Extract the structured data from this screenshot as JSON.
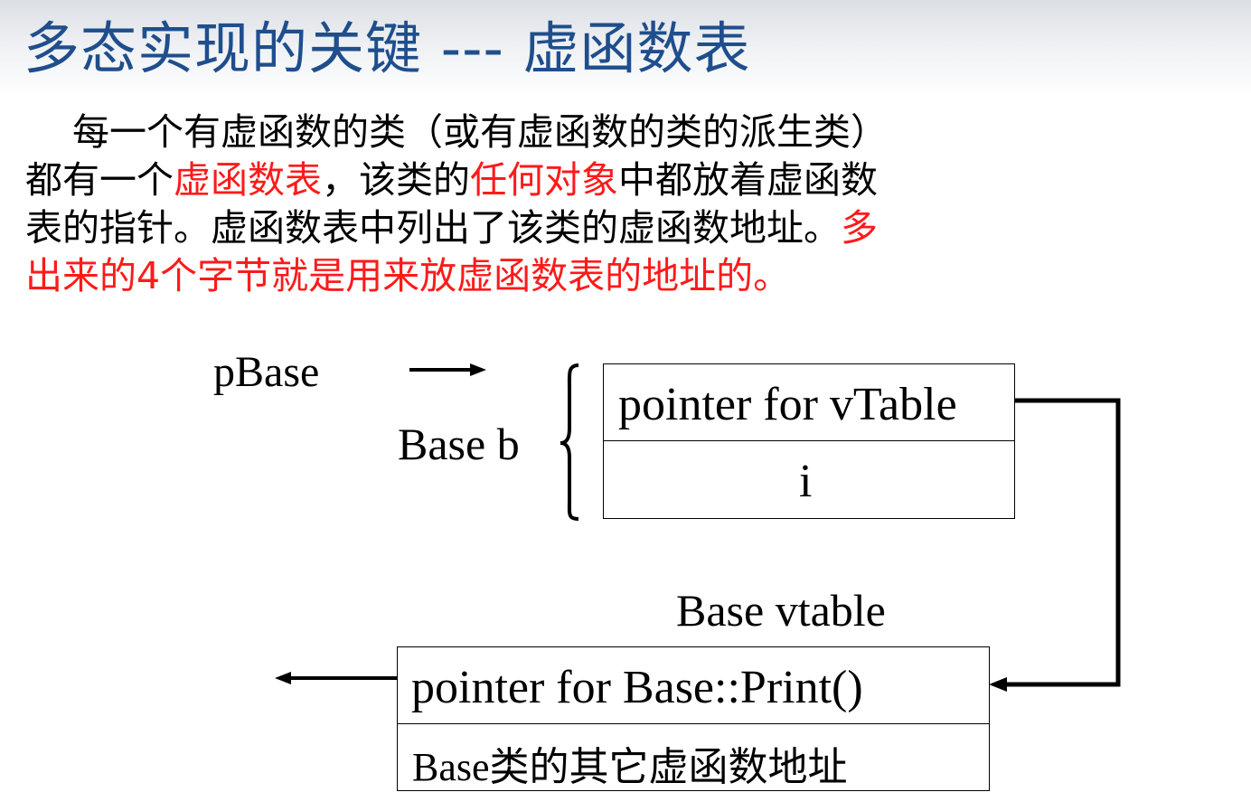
{
  "slide": {
    "title": "多态实现的关键 --- 虚函数表",
    "paragraph": {
      "line1": "每一个有虚函数的类（或有虚函数的类的派生类）",
      "line2_a": "都有一个",
      "line2_red1": "虚函数表",
      "line2_b": "，该类的",
      "line2_red2": "任何对象",
      "line2_c": "中都放着虚函数",
      "line3_a": "表的指针。虚函数表中列出了该类的虚函数地址。",
      "line3_red": "多",
      "line4_red": "出来的4个字节就是用来放虚函数表的地址的。"
    }
  },
  "diagram": {
    "pbase_label": "pBase",
    "base_b_label": "Base b",
    "object_cells": [
      "pointer for vTable",
      "i"
    ],
    "vtable_label": "Base vtable",
    "vtable_cells": [
      "pointer for Base::Print()",
      "Base类的其它虚函数地址"
    ]
  },
  "colors": {
    "title": "#1f4e8c",
    "highlight": "#ff1a1a",
    "text": "#000000"
  }
}
